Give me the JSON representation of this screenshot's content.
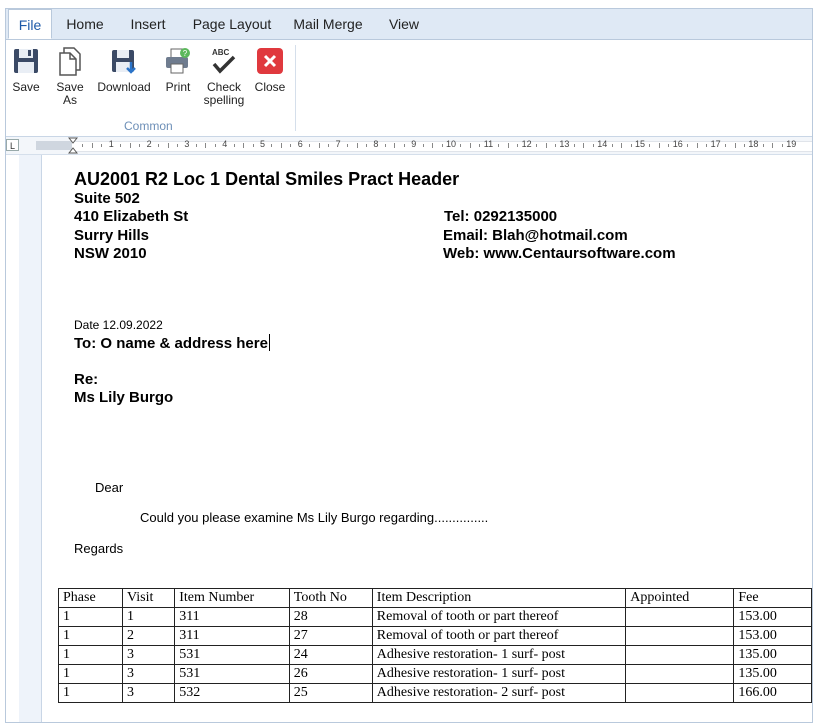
{
  "tabs": [
    {
      "label": "File",
      "active": true
    },
    {
      "label": "Home"
    },
    {
      "label": "Insert"
    },
    {
      "label": "Page Layout"
    },
    {
      "label": "Mail Merge"
    },
    {
      "label": "View"
    }
  ],
  "ribbon": {
    "buttons": [
      {
        "label": "Save",
        "icon": "save-icon"
      },
      {
        "label": "Save As",
        "icon": "save-as-icon"
      },
      {
        "label": "Download",
        "icon": "download-icon"
      },
      {
        "label": "Print",
        "icon": "print-icon"
      },
      {
        "label": "Check spelling",
        "icon": "spellcheck-icon"
      },
      {
        "label": "Close",
        "icon": "close-icon"
      }
    ],
    "group_label": "Common"
  },
  "ruler": {
    "corner": "L",
    "numbers": [
      "1",
      "2",
      "3",
      "4",
      "5",
      "6",
      "7",
      "8",
      "9",
      "10",
      "11",
      "12",
      "13",
      "14",
      "15",
      "16",
      "17",
      "18",
      "19"
    ]
  },
  "document": {
    "header_title": "AU2001 R2 Loc 1 Dental Smiles Pract Header",
    "address": [
      "Suite 502",
      "410 Elizabeth St",
      "Surry Hills",
      "NSW 2010"
    ],
    "contact": [
      "Tel: 0292135000",
      "Email: Blah@hotmail.com",
      "Web: www.Centaursoftware.com"
    ],
    "date_line": "Date  12.09.2022",
    "to_line": "To:  O name & address here",
    "re_label": "Re:",
    "patient_name": "Ms Lily Burgo",
    "salutation": "Dear",
    "body": "Could you please examine Ms Lily Burgo regarding...............",
    "closing": "Regards",
    "table": {
      "headers": [
        "Phase",
        "Visit",
        "Item Number",
        "Tooth No",
        "Item Description",
        "Appointed",
        "Fee"
      ],
      "rows": [
        [
          "1",
          "1",
          "311",
          "28",
          "Removal of tooth or part thereof",
          "",
          "153.00"
        ],
        [
          "1",
          "2",
          "311",
          "27",
          "Removal of tooth or part thereof",
          "",
          "153.00"
        ],
        [
          "1",
          "3",
          "531",
          "24",
          "Adhesive restoration- 1 surf- post",
          "",
          "135.00"
        ],
        [
          "1",
          "3",
          "531",
          "26",
          "Adhesive restoration- 1 surf- post",
          "",
          "135.00"
        ],
        [
          "1",
          "3",
          "532",
          "25",
          "Adhesive restoration- 2 surf- post",
          "",
          "166.00"
        ]
      ]
    }
  },
  "colors": {
    "accent": "#1e5aa8",
    "tab_bar": "#dfe9f5",
    "group_label": "#6d8fb7"
  }
}
